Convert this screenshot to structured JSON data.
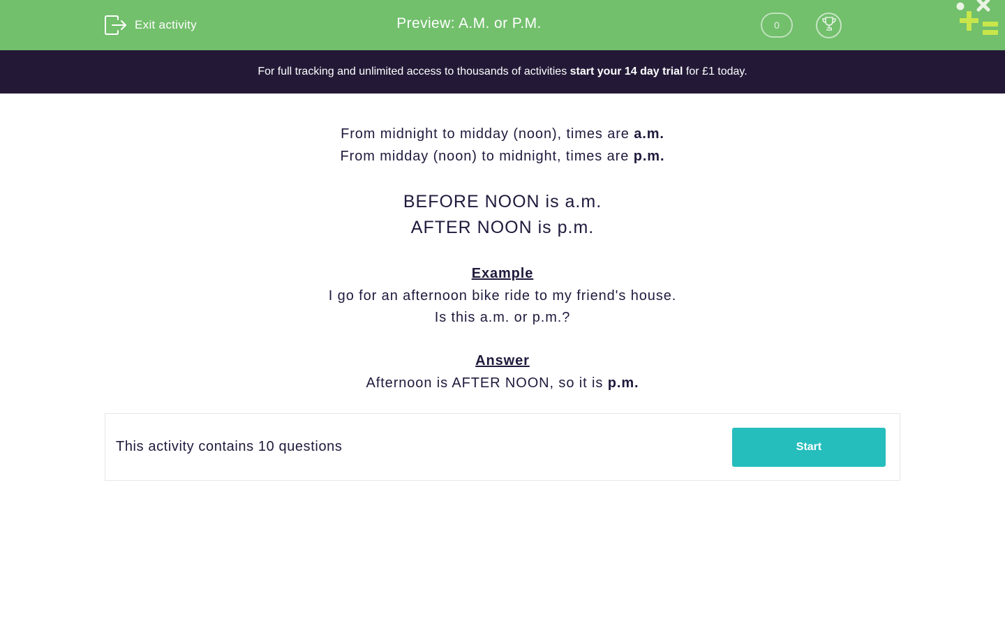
{
  "header": {
    "exit_label": "Exit activity",
    "title": "Preview: A.M. or P.M.",
    "score": "0"
  },
  "banner": {
    "text_before": "For full tracking and unlimited access to thousands of activities ",
    "text_bold": "start your 14 day trial",
    "text_after": " for £1 today."
  },
  "intro": {
    "line1_prefix": "From midnight to midday (noon), times are ",
    "line1_bold": "a.m.",
    "line2_prefix": "From midday (noon) to midnight, times are ",
    "line2_bold": "p.m."
  },
  "rule": {
    "line1": "BEFORE NOON is a.m.",
    "line2": "AFTER NOON is p.m."
  },
  "example": {
    "heading": "Example",
    "line1": "I go for an afternoon bike ride to my friend's house.",
    "line2": "Is this a.m. or p.m.?"
  },
  "answer": {
    "heading": "Answer",
    "text_prefix": "Afternoon is AFTER NOON, so it is ",
    "text_bold": "p.m."
  },
  "card": {
    "text": "This activity contains 10 questions",
    "start_label": "Start"
  },
  "colors": {
    "header_bg": "#72bf6c",
    "banner_bg": "#231937",
    "text": "#1f1a3c",
    "start_button": "#26bdbd",
    "logo_lime": "#c8e64b"
  }
}
